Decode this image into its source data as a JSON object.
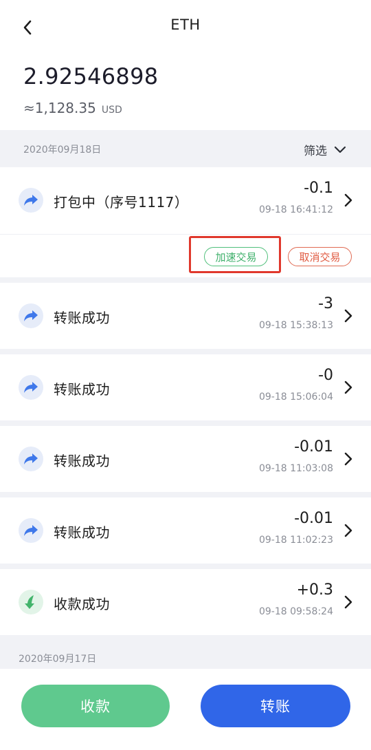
{
  "header": {
    "title": "ETH"
  },
  "balance": {
    "amount": "2.92546898",
    "fiat_value": "≈1,128.35",
    "fiat_unit": "USD"
  },
  "filter": {
    "label": "筛选"
  },
  "groups": [
    {
      "date": "2020年09月18日"
    },
    {
      "date": "2020年09月17日"
    }
  ],
  "transactions": [
    {
      "type": "out",
      "label": "打包中（序号1117）",
      "amount": "-0.1",
      "time": "09-18 16:41:12"
    },
    {
      "type": "out",
      "label": "转账成功",
      "amount": "-3",
      "time": "09-18 15:38:13"
    },
    {
      "type": "out",
      "label": "转账成功",
      "amount": "-0",
      "time": "09-18 15:06:04"
    },
    {
      "type": "out",
      "label": "转账成功",
      "amount": "-0.01",
      "time": "09-18 11:03:08"
    },
    {
      "type": "out",
      "label": "转账成功",
      "amount": "-0.01",
      "time": "09-18 11:02:23"
    },
    {
      "type": "in",
      "label": "收款成功",
      "amount": "+0.3",
      "time": "09-18 09:58:24"
    }
  ],
  "pending_actions": {
    "speed_up": "加速交易",
    "cancel": "取消交易"
  },
  "buttons": {
    "receive": "收款",
    "transfer": "转账"
  },
  "colors": {
    "accent_blue": "#3066e8",
    "accent_green": "#5fc98e",
    "highlight_red": "#e0382c",
    "cancel_red": "#e05a40",
    "speed_green": "#3fb06b"
  }
}
